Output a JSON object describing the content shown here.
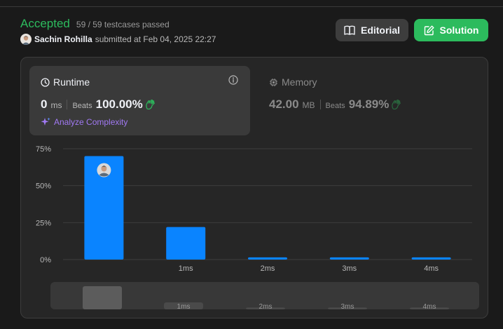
{
  "header": {
    "status": "Accepted",
    "testcases": "59 / 59 testcases passed",
    "submitter_name": "Sachin Rohilla",
    "submitted_at": "submitted at Feb 04, 2025 22:27"
  },
  "buttons": {
    "editorial": "Editorial",
    "solution": "Solution"
  },
  "runtime": {
    "label": "Runtime",
    "value": "0",
    "unit": "ms",
    "beats_label": "Beats",
    "beats_value": "100.00%",
    "analyze": "Analyze Complexity"
  },
  "memory": {
    "label": "Memory",
    "value": "42.00",
    "unit": "MB",
    "beats_label": "Beats",
    "beats_value": "94.89%"
  },
  "colors": {
    "accepted": "#2cbb5d",
    "bar": "#0a84ff",
    "analyze": "#a179f3",
    "beats_icon": "#2cbb5d"
  },
  "chart_data": {
    "type": "bar",
    "categories": [
      "",
      "1ms",
      "2ms",
      "3ms",
      "4ms"
    ],
    "values": [
      70,
      22,
      1.5,
      1.5,
      1.5
    ],
    "y_ticks": [
      "0%",
      "25%",
      "50%",
      "75%"
    ],
    "ylim": [
      0,
      75
    ],
    "grid": true,
    "highlight_index": 0,
    "mini_values": [
      100,
      30,
      8,
      8,
      8
    ]
  }
}
